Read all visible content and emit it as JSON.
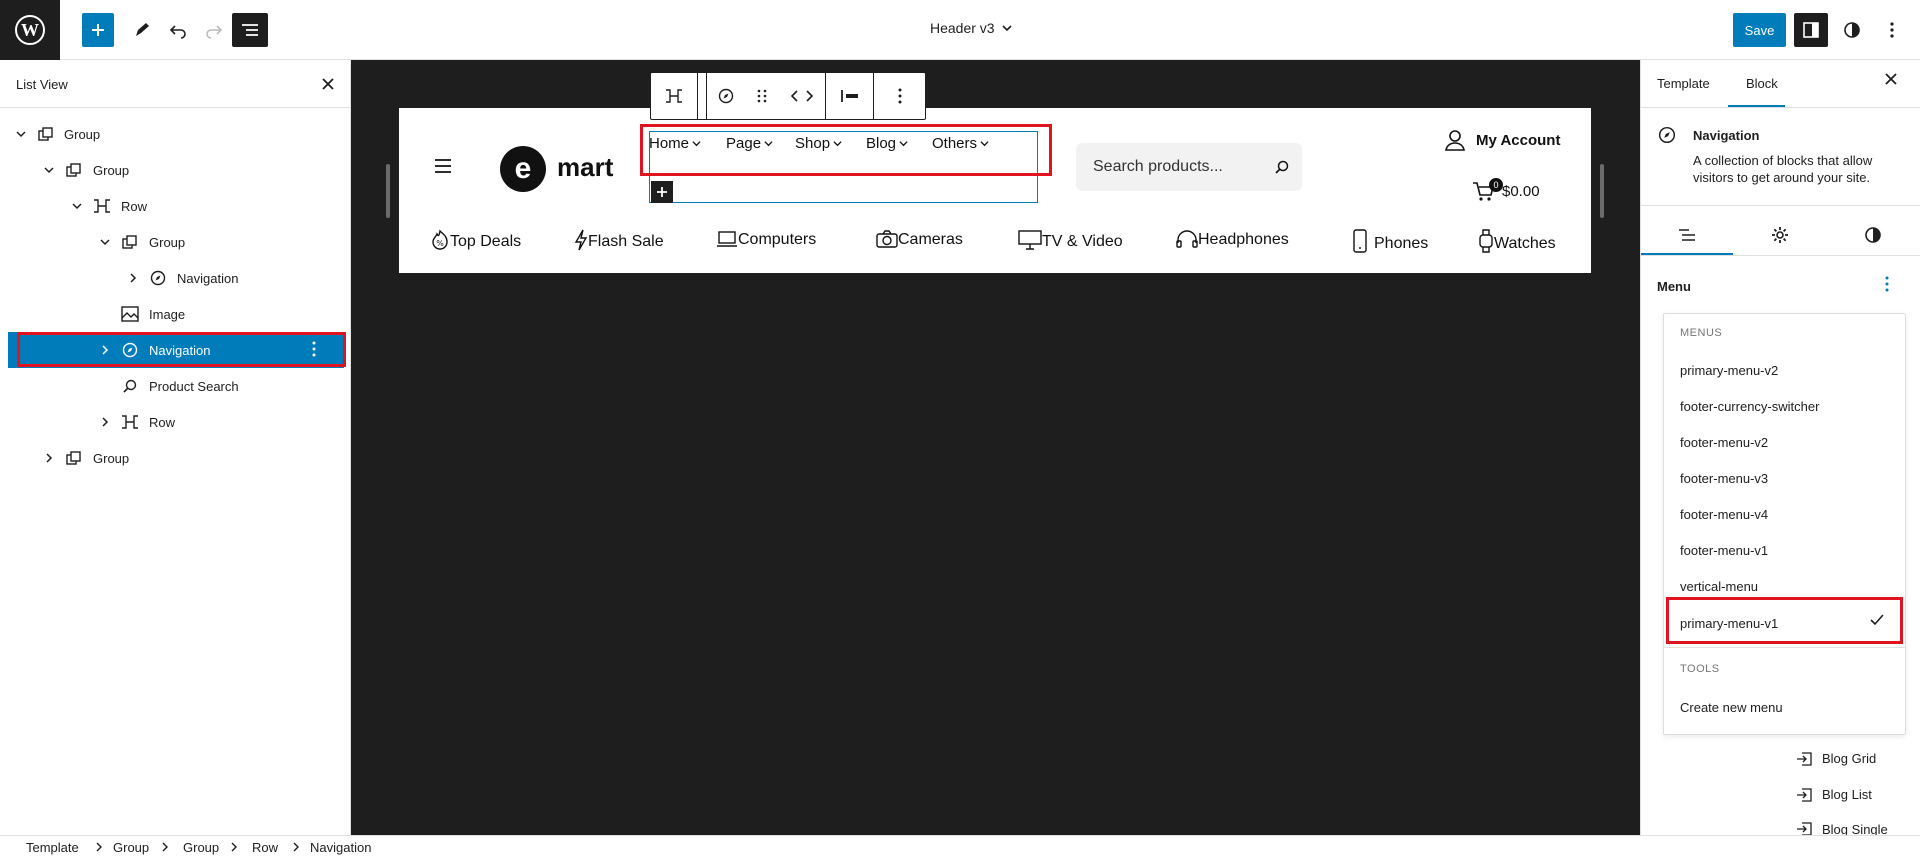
{
  "topbar": {
    "document_title": "Header v3",
    "save_label": "Save"
  },
  "list_view": {
    "title": "List View",
    "items": [
      {
        "label": "Group",
        "icon": "group-icon"
      },
      {
        "label": "Group",
        "icon": "group-icon"
      },
      {
        "label": "Row",
        "icon": "row-icon"
      },
      {
        "label": "Group",
        "icon": "group-icon"
      },
      {
        "label": "Navigation",
        "icon": "navigation-icon"
      },
      {
        "label": "Image",
        "icon": "image-icon"
      },
      {
        "label": "Navigation",
        "icon": "navigation-icon",
        "selected": true
      },
      {
        "label": "Product Search",
        "icon": "search-icon"
      },
      {
        "label": "Row",
        "icon": "row-icon"
      },
      {
        "label": "Group",
        "icon": "group-icon"
      }
    ]
  },
  "canvas": {
    "logo_letter": "e",
    "logo_text": "mart",
    "nav_items": [
      "Home",
      "Page",
      "Shop",
      "Blog",
      "Others"
    ],
    "search_placeholder": "Search products...",
    "account_label": "My Account",
    "cart_count": "0",
    "cart_total": "$0.00",
    "categories": [
      {
        "label": "Top Deals",
        "icon": "percent-badge-icon"
      },
      {
        "label": "Flash Sale",
        "icon": "lightning-icon"
      },
      {
        "label": "Computers",
        "icon": "laptop-icon"
      },
      {
        "label": "Cameras",
        "icon": "camera-icon"
      },
      {
        "label": "TV & Video",
        "icon": "tv-icon"
      },
      {
        "label": "Headphones",
        "icon": "headphones-icon"
      },
      {
        "label": "Phones",
        "icon": "phone-icon"
      },
      {
        "label": "Watches",
        "icon": "watch-icon"
      }
    ]
  },
  "sidebar": {
    "tabs": [
      "Template",
      "Block"
    ],
    "active_tab": "Block",
    "block_title": "Navigation",
    "block_description": "A collection of blocks that allow visitors to get around your site.",
    "menu_label": "Menu",
    "dropdown": {
      "menus_heading": "MENUS",
      "menus": [
        "primary-menu-v2",
        "footer-currency-switcher",
        "footer-menu-v2",
        "footer-menu-v3",
        "footer-menu-v4",
        "footer-menu-v1",
        "vertical-menu",
        "primary-menu-v1"
      ],
      "selected": "primary-menu-v1",
      "tools_heading": "TOOLS",
      "tools": [
        "Create new menu"
      ]
    },
    "links": [
      "Blog Grid",
      "Blog List",
      "Blog Single"
    ]
  },
  "breadcrumb": [
    "Template",
    "Group",
    "Group",
    "Row",
    "Navigation"
  ],
  "colors": {
    "accent": "#007cba",
    "highlight": "#e0141e",
    "canvas_bg": "#1e1e1e"
  }
}
